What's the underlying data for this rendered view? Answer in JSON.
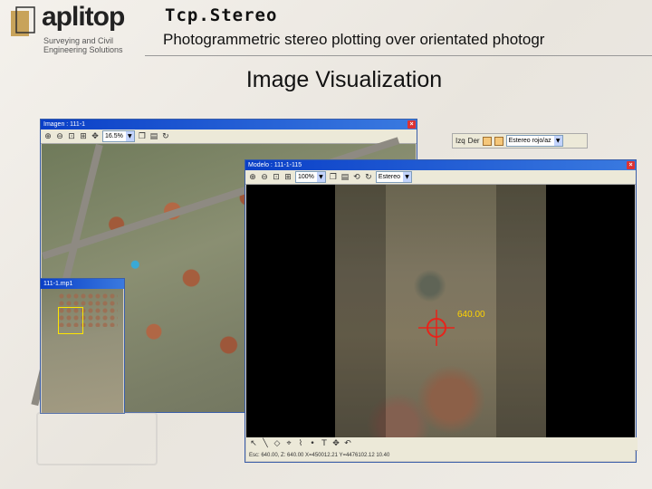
{
  "header": {
    "logo_text": "aplitop",
    "logo_sub": "Surveying and Civil Engineering Solutions",
    "app_title": "Tcp.Stereo",
    "app_subtitle": "Photogrammetric stereo plotting over orientated photogr",
    "section_heading": "Image Visualization"
  },
  "image_window": {
    "title": "Imagen : 111-1",
    "zoom_value": "16.5%"
  },
  "overview_window": {
    "title": "111-1.mp1"
  },
  "model_window": {
    "title": "Modelo : 111-1-115",
    "zoom_value": "100%",
    "mode_value": "Estereo",
    "coord_readout": "640.00",
    "status_text": "Esc: 640.00, Z: 640.00 X=450012.21 Y=4476102.12 10.40"
  },
  "lr_toolbar": {
    "left_label": "Izq",
    "right_label": "Der",
    "mode_value": "Estereo rojo/az"
  },
  "colors": {
    "titlebar": "#0a3fc7",
    "cursor": "#e8231a",
    "readout": "#ffd400"
  }
}
